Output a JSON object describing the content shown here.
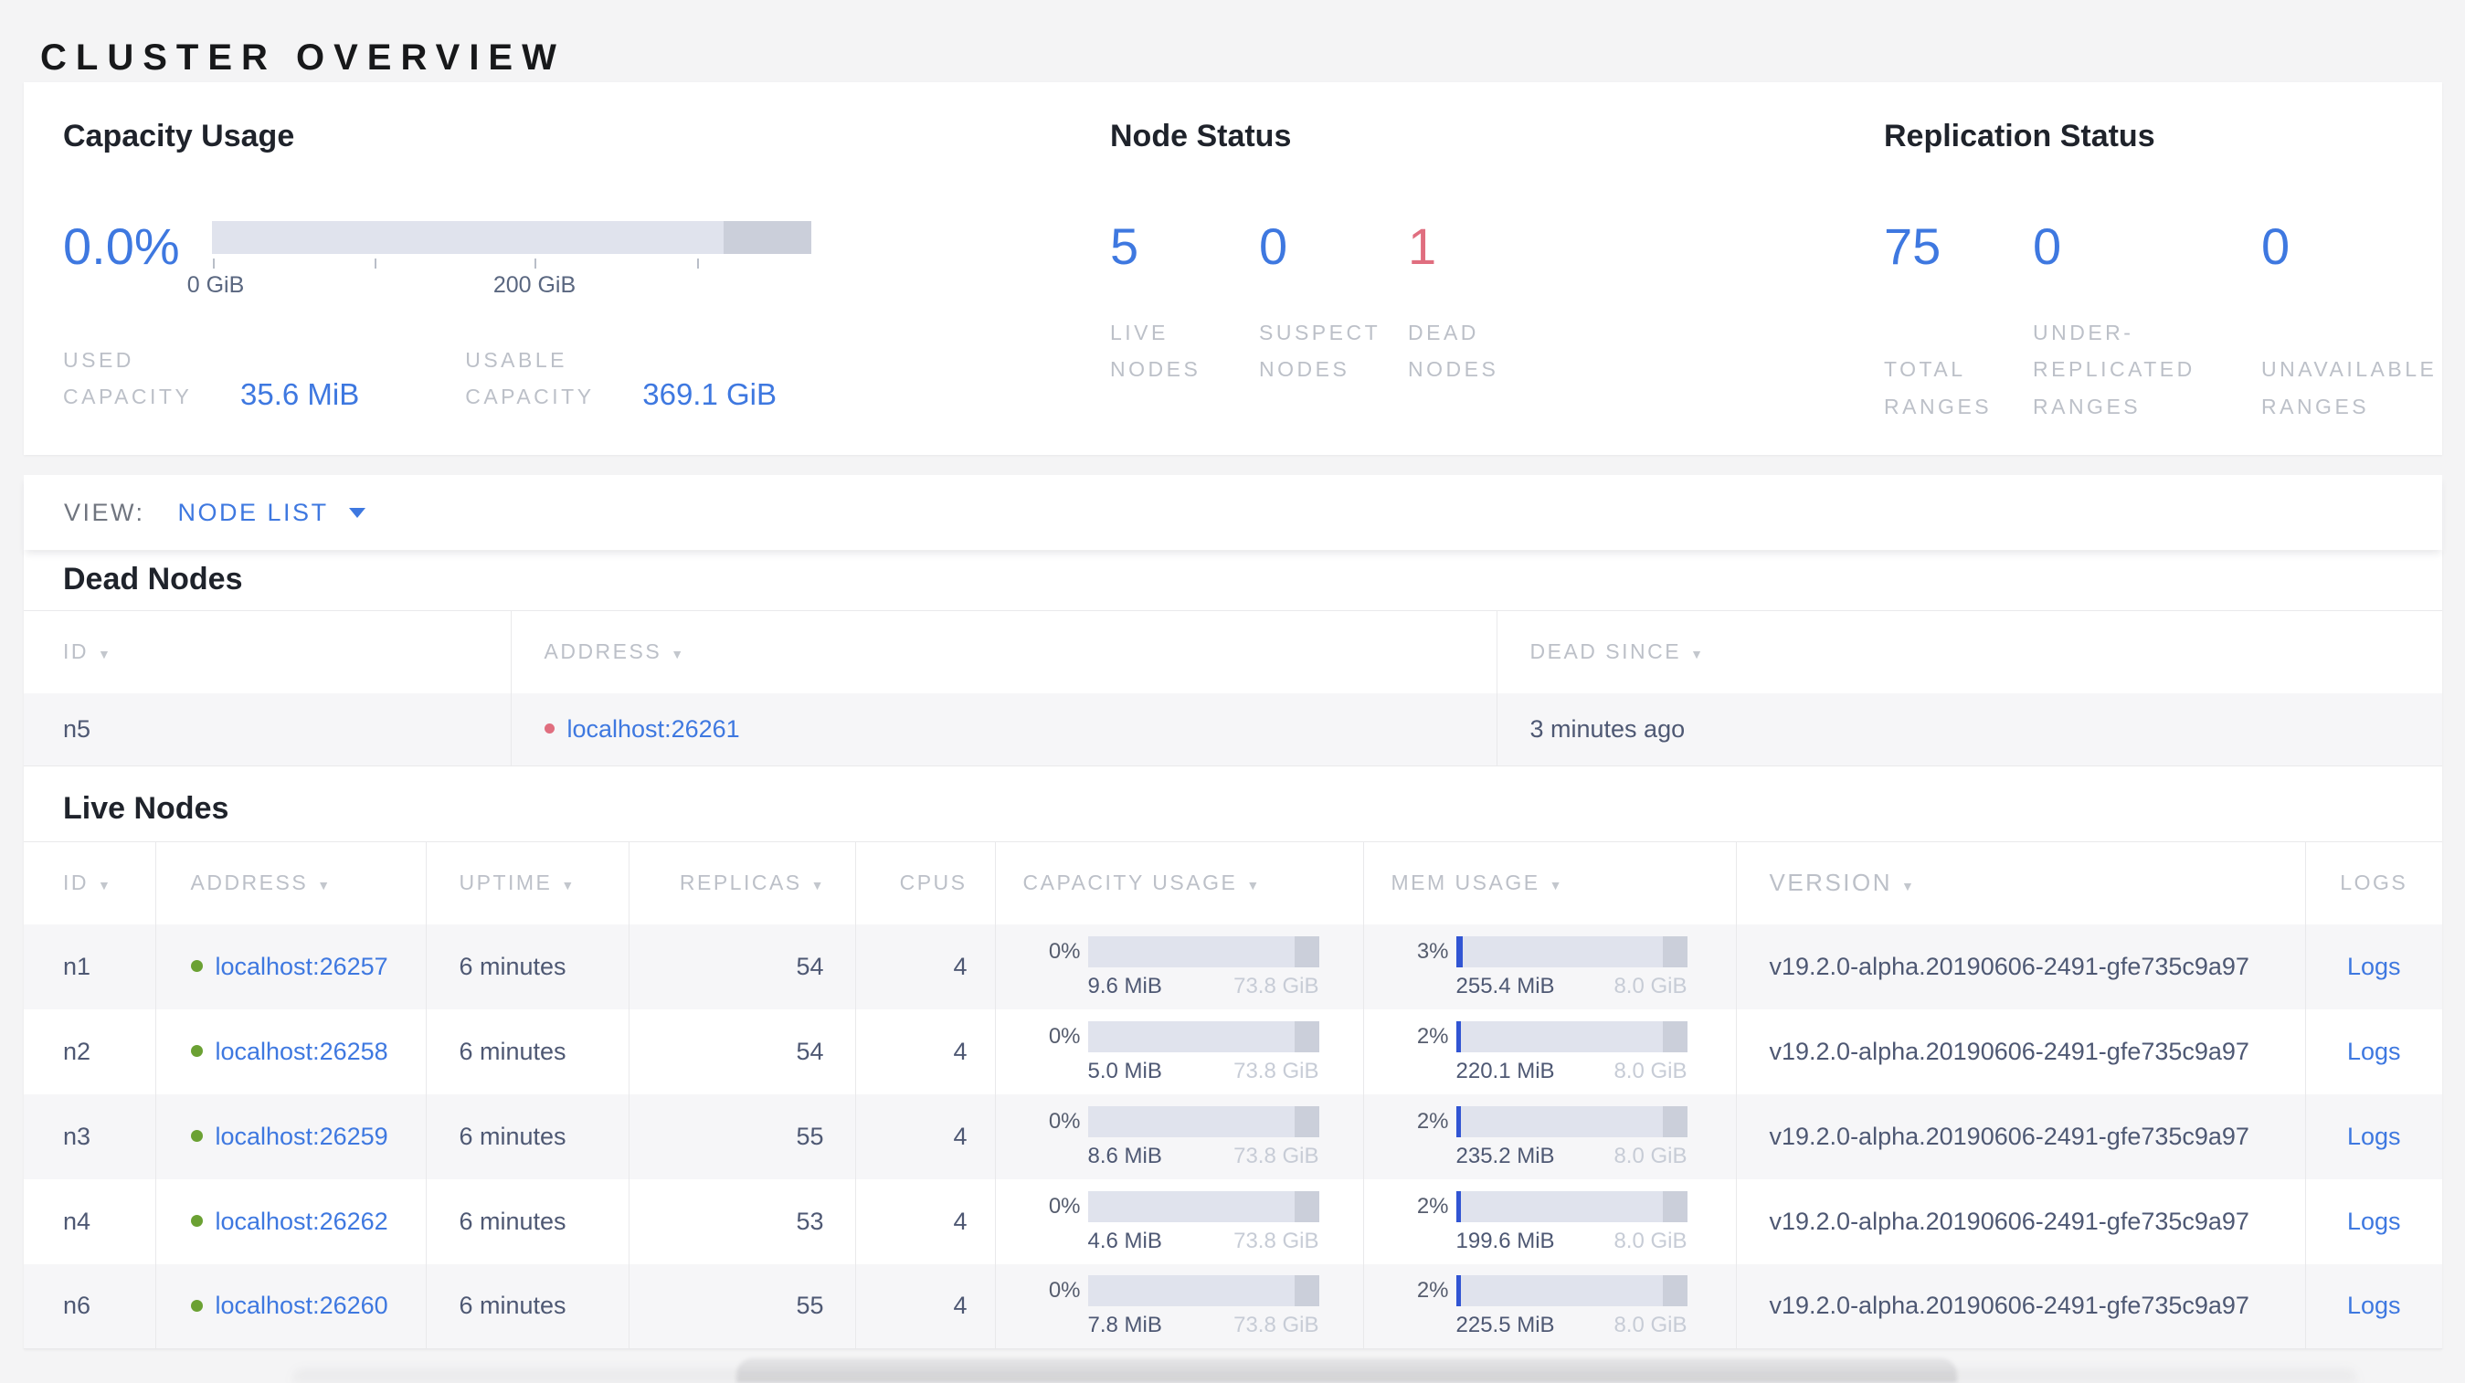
{
  "title": "CLUSTER OVERVIEW",
  "colors": {
    "page_background": "#f4f4f5",
    "accent_blue": "#3e78e0",
    "danger_red": "#e06e7f",
    "live_green": "#6ba133",
    "bar_track": "#e0e3ed",
    "bar_other_segment": "#cbcfda",
    "bar_fill_blue": "#3155d3"
  },
  "summary": {
    "capacity": {
      "heading": "Capacity Usage",
      "percent": "0.0%",
      "tick_labels": [
        "0 GiB",
        "200 GiB"
      ],
      "stats": [
        {
          "label": "USED CAPACITY",
          "value": "35.6 MiB"
        },
        {
          "label": "USABLE CAPACITY",
          "value": "369.1 GiB"
        }
      ]
    },
    "node_status": {
      "heading": "Node Status",
      "stats": [
        {
          "value": "5",
          "label": "LIVE NODES",
          "tone": "blue"
        },
        {
          "value": "0",
          "label": "SUSPECT NODES",
          "tone": "blue"
        },
        {
          "value": "1",
          "label": "DEAD NODES",
          "tone": "red"
        }
      ]
    },
    "replication": {
      "heading": "Replication Status",
      "stats": [
        {
          "value": "75",
          "label": "TOTAL RANGES",
          "tone": "blue"
        },
        {
          "value": "0",
          "label": "UNDER-REPLICATED RANGES",
          "tone": "blue"
        },
        {
          "value": "0",
          "label": "UNAVAILABLE RANGES",
          "tone": "blue"
        }
      ]
    }
  },
  "view_bar": {
    "label": "VIEW:",
    "selected": "NODE LIST"
  },
  "dead_nodes": {
    "heading": "Dead Nodes",
    "columns": [
      "ID",
      "ADDRESS",
      "DEAD SINCE"
    ],
    "sortable": [
      true,
      true,
      true
    ],
    "rows": [
      {
        "id": "n5",
        "address": "localhost:26261",
        "dead_since": "3 minutes ago"
      }
    ]
  },
  "live_nodes": {
    "heading": "Live Nodes",
    "logs_label": "Logs",
    "columns": [
      "ID",
      "ADDRESS",
      "UPTIME",
      "REPLICAS",
      "CPUS",
      "CAPACITY USAGE",
      "MEM USAGE",
      "VERSION",
      "LOGS"
    ],
    "sortable": [
      true,
      true,
      true,
      true,
      false,
      true,
      true,
      true,
      false
    ],
    "rows": [
      {
        "id": "n1",
        "address": "localhost:26257",
        "uptime": "6 minutes",
        "replicas": "54",
        "cpus": "4",
        "capacity": {
          "percent": "0%",
          "used": "9.6 MiB",
          "total": "73.8 GiB",
          "fill_pct": 0
        },
        "memory": {
          "percent": "3%",
          "used": "255.4 MiB",
          "total": "8.0 GiB",
          "fill_pct": 3
        },
        "version": "v19.2.0-alpha.20190606-2491-gfe735c9a97"
      },
      {
        "id": "n2",
        "address": "localhost:26258",
        "uptime": "6 minutes",
        "replicas": "54",
        "cpus": "4",
        "capacity": {
          "percent": "0%",
          "used": "5.0 MiB",
          "total": "73.8 GiB",
          "fill_pct": 0
        },
        "memory": {
          "percent": "2%",
          "used": "220.1 MiB",
          "total": "8.0 GiB",
          "fill_pct": 2
        },
        "version": "v19.2.0-alpha.20190606-2491-gfe735c9a97"
      },
      {
        "id": "n3",
        "address": "localhost:26259",
        "uptime": "6 minutes",
        "replicas": "55",
        "cpus": "4",
        "capacity": {
          "percent": "0%",
          "used": "8.6 MiB",
          "total": "73.8 GiB",
          "fill_pct": 0
        },
        "memory": {
          "percent": "2%",
          "used": "235.2 MiB",
          "total": "8.0 GiB",
          "fill_pct": 2
        },
        "version": "v19.2.0-alpha.20190606-2491-gfe735c9a97"
      },
      {
        "id": "n4",
        "address": "localhost:26262",
        "uptime": "6 minutes",
        "replicas": "53",
        "cpus": "4",
        "capacity": {
          "percent": "0%",
          "used": "4.6 MiB",
          "total": "73.8 GiB",
          "fill_pct": 0
        },
        "memory": {
          "percent": "2%",
          "used": "199.6 MiB",
          "total": "8.0 GiB",
          "fill_pct": 2
        },
        "version": "v19.2.0-alpha.20190606-2491-gfe735c9a97"
      },
      {
        "id": "n6",
        "address": "localhost:26260",
        "uptime": "6 minutes",
        "replicas": "55",
        "cpus": "4",
        "capacity": {
          "percent": "0%",
          "used": "7.8 MiB",
          "total": "73.8 GiB",
          "fill_pct": 0
        },
        "memory": {
          "percent": "2%",
          "used": "225.5 MiB",
          "total": "8.0 GiB",
          "fill_pct": 2
        },
        "version": "v19.2.0-alpha.20190606-2491-gfe735c9a97"
      }
    ]
  }
}
